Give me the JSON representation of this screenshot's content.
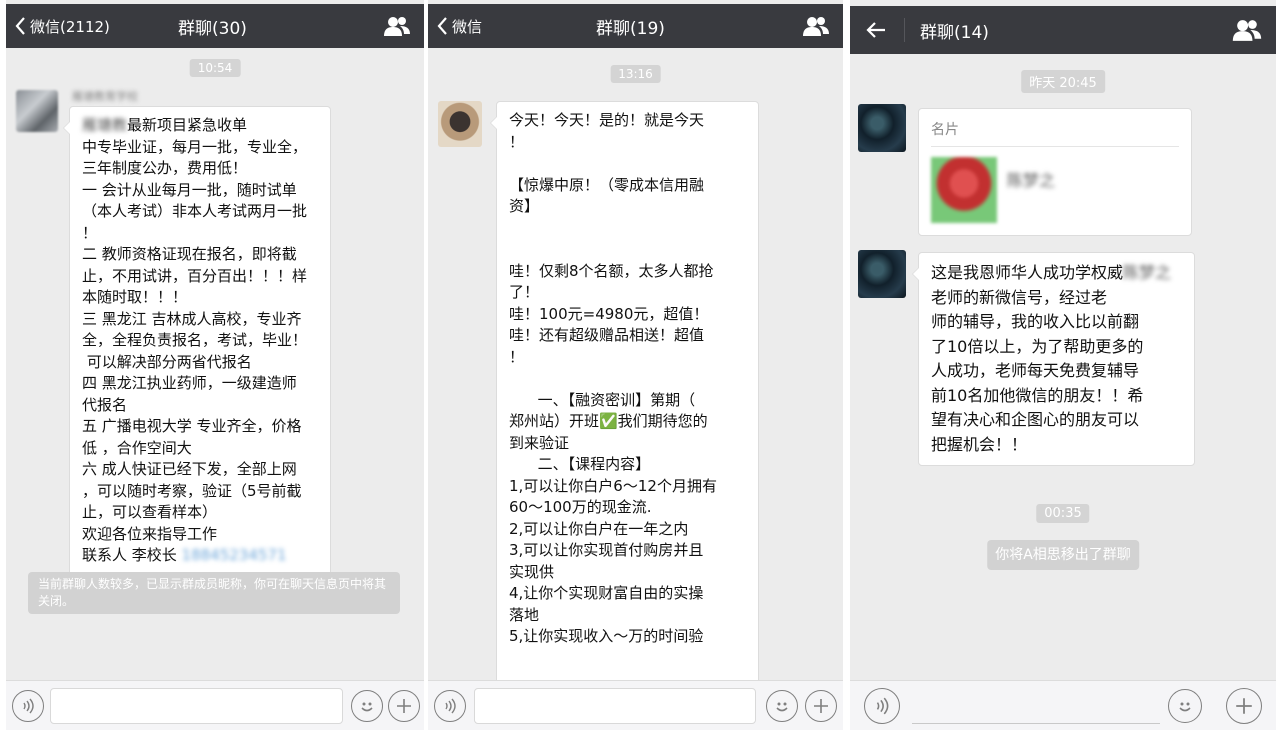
{
  "panels": [
    {
      "header": {
        "back_label": "微信(2112)",
        "title": "群聊(30)"
      },
      "time": "10:54",
      "sender_name": "雁塘教育学校",
      "message": {
        "blurred_prefix": "雁塘教",
        "text": "最新项目紧急收单\n中专毕业证，每月一批，专业全，\n三年制度公办，费用低！\n一 会计从业每月一批，随时试单\n（本人考试）非本人考试两月一批\n！\n二 教师资格证现在报名，即将截\n止，不用试讲，百分百出！！！样\n本随时取！！！\n三 黑龙江 吉林成人高校，专业齐\n全，全程负责报名，考试，毕业！\n 可以解决部分两省代报名\n四 黑龙江执业药师，一级建造师\n代报名\n五 广播电视大学 专业齐全，价格\n低 ，合作空间大\n六 成人快证已经下发，全部上网\n，可以随时考察，验证（5号前截\n止，可以查看样本）\n欢迎各位来指导工作\n联系人 李校长 ",
        "blurred_suffix": "18845234571"
      },
      "system_note": "当前群聊人数较多，已显示群成员昵称，你可在聊天信息页中将其关闭。"
    },
    {
      "header": {
        "back_label": "微信",
        "title": "群聊(19)"
      },
      "time": "13:16",
      "message": {
        "text": "今天！今天！是的！就是今天\n！\n\n【惊爆中原！（零成本信用融\n资】\n\n\n哇！仅剩8个名额，太多人都抢\n了！\n哇！100元=4980元，超值！\n哇！还有超级赠品相送！超值\n！\n\n      一、【融资密训】第期（\n郑州站）开班✅我们期待您的\n到来验证\n      二、【课程内容】\n1,可以让你白户6～12个月拥有\n60～100万的现金流.\n2,可以让你白户在一年之内\n3,可以让你实现首付购房并且\n实现供\n4,让你个实现财富自由的实操\n落地\n5,让你实现收入～万的时间验"
      }
    },
    {
      "header": {
        "back_label": "",
        "title": "群聊(14)"
      },
      "time_1": "昨天 20:45",
      "card": {
        "label": "名片",
        "name": "陈梦之"
      },
      "message": {
        "text_a": "这是我恩师华人成功学权威",
        "blurred": "陈梦之",
        "text_b": "老师的新微信号，经过老\n师的辅导，我的收入比以前翻\n了10倍以上，为了帮助更多的\n人成功，老师每天免费复辅导\n前10名加他微信的朋友！！希\n望有决心和企图心的朋友可以\n把握机会！！"
      },
      "time_2": "00:35",
      "system_note": "你将A相思移出了群聊"
    }
  ]
}
